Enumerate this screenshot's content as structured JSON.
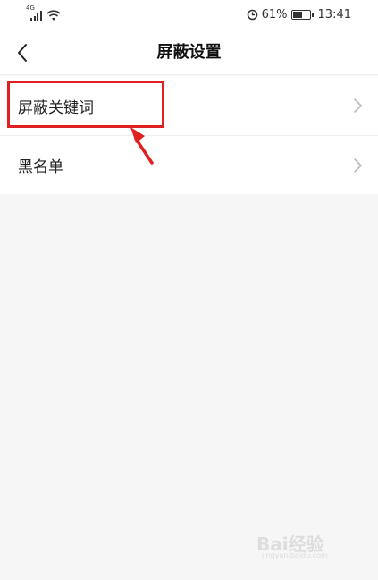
{
  "status_bar": {
    "signal_label": "4G",
    "battery_percent": "61%",
    "battery_level": 0.61,
    "time": "13:41",
    "icons": [
      "signal-icon",
      "wifi-icon",
      "data-saver-icon",
      "battery-icon"
    ]
  },
  "header": {
    "back_icon": "chevron-left-icon",
    "title": "屏蔽设置"
  },
  "settings": {
    "items": [
      {
        "label": "屏蔽关键词",
        "icon": "chevron-right-icon"
      },
      {
        "label": "黑名单",
        "icon": "chevron-right-icon"
      }
    ]
  },
  "annotation": {
    "highlight_color": "#e02020"
  },
  "watermark": {
    "text": "Bai经验",
    "sub": "jingyan.baidu.com"
  }
}
